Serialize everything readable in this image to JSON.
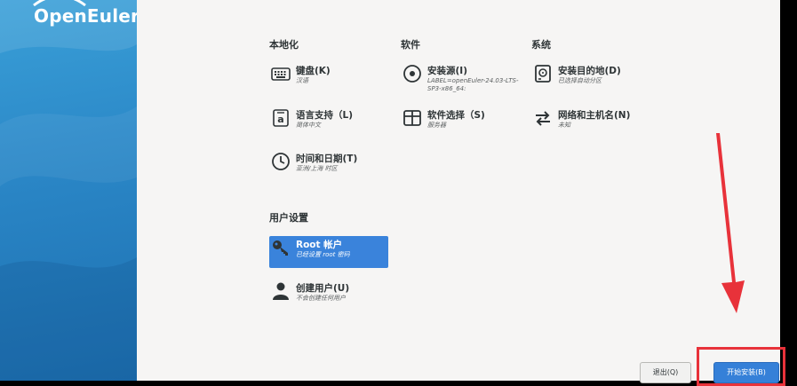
{
  "brand": {
    "logo_text": "OpenEuler"
  },
  "sections": {
    "localization": "本地化",
    "software": "软件",
    "system": "系统",
    "user_settings": "用户设置"
  },
  "spokes": {
    "keyboard": {
      "title": "键盘(K)",
      "status": "汉语",
      "icon": "keyboard-icon"
    },
    "language": {
      "title": "语言支持（L)",
      "status": "简体中文",
      "icon": "language-icon"
    },
    "datetime": {
      "title": "时间和日期(T)",
      "status": "亚洲/上海 时区",
      "icon": "clock-icon"
    },
    "source": {
      "title": "安装源(I)",
      "status1": "LABEL=openEuler-24.03-LTS-",
      "status2": "SP3-x86_64:",
      "icon": "disc-icon"
    },
    "software_selection": {
      "title": "软件选择（S)",
      "status": "服务器",
      "icon": "package-icon"
    },
    "destination": {
      "title": "安装目的地(D)",
      "status": "已选择自动分区",
      "icon": "harddisk-icon"
    },
    "network": {
      "title": "网络和主机名(N)",
      "status": "未知",
      "icon": "network-arrows-icon"
    },
    "root": {
      "title": "Root 帐户",
      "status": "已经设置 root 密码",
      "icon": "key-icon",
      "selected": true
    },
    "user": {
      "title": "创建用户(U)",
      "status": "不会创建任何用户",
      "icon": "user-icon"
    }
  },
  "buttons": {
    "quit": "退出(Q)",
    "begin": "开始安装(B)"
  },
  "colors": {
    "sidebar": "#2a86c6",
    "selected": "#3a83db",
    "primary_button": "#3580d8",
    "annotation": "#e8323a"
  }
}
